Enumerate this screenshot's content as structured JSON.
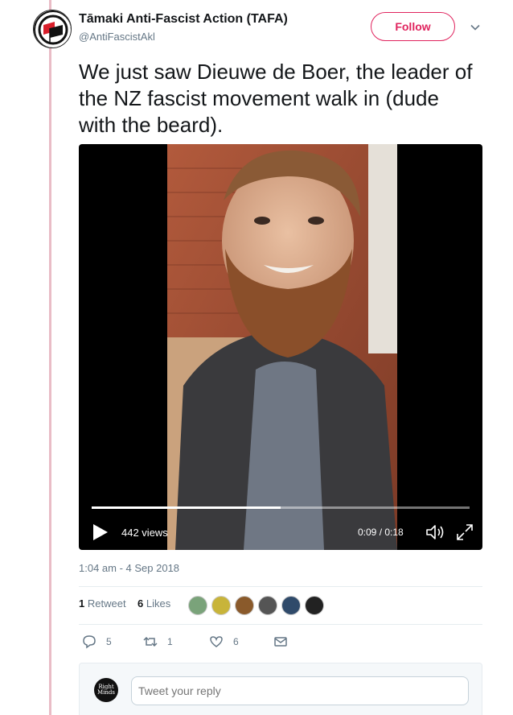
{
  "author": {
    "name": "Tāmaki Anti-Fascist Action (TAFA)",
    "handle": "@AntiFascistAkl",
    "avatar_icon": "antifa-flag-icon"
  },
  "follow_label": "Follow",
  "tweet": {
    "text": "We just saw Dieuwe de Boer, the leader of the NZ fascist movement walk in (dude with the beard).",
    "timestamp": "1:04 am - 4 Sep 2018"
  },
  "video": {
    "views": "442 views",
    "time": "0:09 / 0:18",
    "progress": 0.5
  },
  "stats": {
    "retweet_count": "1",
    "retweet_label": "Retweet",
    "likes_count": "6",
    "likes_label": "Likes"
  },
  "actions": {
    "reply_count": "5",
    "retweet_count": "1",
    "like_count": "6"
  },
  "reply": {
    "placeholder": "Tweet your reply",
    "avatar_text": "Right Minds"
  },
  "colors": {
    "follow": "#e0245e",
    "thread_line": "#e9bcc6",
    "secondary_text": "#657786"
  }
}
